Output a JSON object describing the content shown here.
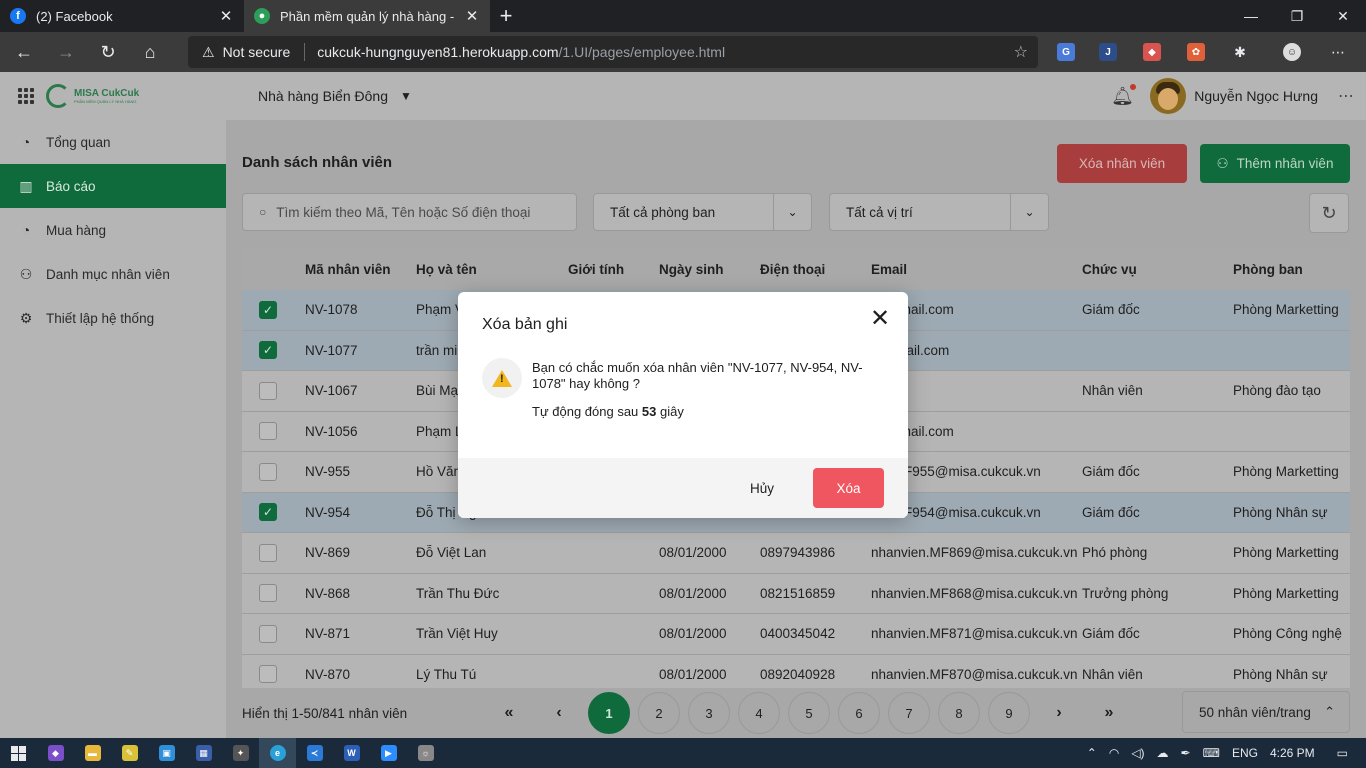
{
  "browser": {
    "tabs": [
      {
        "title": "(2) Facebook",
        "favicon": "facebook-icon",
        "active": false
      },
      {
        "title": "Phần mềm quản lý nhà hàng - C",
        "favicon": "misa-icon",
        "active": true
      }
    ],
    "security_label": "Not secure",
    "url_host": "cukcuk-hungnguyen81.herokuapp.com",
    "url_path": "/1.UI/pages/employee.html"
  },
  "app": {
    "logo_text": "MISA CukCuk",
    "logo_sub": "PHẦN MỀM QUẢN LÝ NHÀ HÀNG",
    "restaurant": "Nhà hàng Biển Đông",
    "user_name": "Nguyễn Ngọc Hưng",
    "sidebar": [
      {
        "label": "Tổng quan",
        "icon": "pie-chart-icon",
        "active": false
      },
      {
        "label": "Báo cáo",
        "icon": "bar-chart-icon",
        "active": true
      },
      {
        "label": "Mua hàng",
        "icon": "pie-chart-icon",
        "active": false
      },
      {
        "label": "Danh mục nhân viên",
        "icon": "users-icon",
        "active": false
      },
      {
        "label": "Thiết lập hệ thống",
        "icon": "gear-icon",
        "active": false
      }
    ]
  },
  "main": {
    "title": "Danh sách nhân viên",
    "delete_button": "Xóa nhân viên",
    "add_button": "Thêm nhân viên",
    "search_placeholder": "Tìm kiếm theo Mã, Tên hoặc Số điện thoại",
    "department_filter": "Tất cả phòng ban",
    "position_filter": "Tất cả vị trí",
    "columns": [
      "Mã nhân viên",
      "Họ và tên",
      "Giới tính",
      "Ngày sinh",
      "Điện thoại",
      "Email",
      "Chức vụ",
      "Phòng ban"
    ],
    "rows": [
      {
        "checked": true,
        "code": "NV-1078",
        "name": "Phạm V",
        "gender": "",
        "dob": "",
        "phone": "",
        "email": "2@gmail.com",
        "position": "Giám đốc",
        "dept": "Phòng Marketting"
      },
      {
        "checked": true,
        "code": "NV-1077",
        "name": "trần mi",
        "gender": "",
        "dob": "",
        "phone": "",
        "email": "le@mail.com",
        "position": "",
        "dept": ""
      },
      {
        "checked": false,
        "code": "NV-1067",
        "name": "Bùi Mạ",
        "gender": "",
        "dob": "",
        "phone": "",
        "email": "as",
        "position": "Nhân viên",
        "dept": "Phòng đào tạo"
      },
      {
        "checked": false,
        "code": "NV-1056",
        "name": "Phạm L",
        "gender": "",
        "dob": "",
        "phone": "",
        "email": "2@gmail.com",
        "position": "",
        "dept": ""
      },
      {
        "checked": false,
        "code": "NV-955",
        "name": "Hồ Văn",
        "gender": "",
        "dob": "",
        "phone": "",
        "email": "ien.MF955@misa.cukcuk.vn",
        "position": "Giám đốc",
        "dept": "Phòng Marketting"
      },
      {
        "checked": true,
        "code": "NV-954",
        "name": "Đỗ Thị Ng",
        "gender": "",
        "dob": "",
        "phone": "",
        "email": "ien.MF954@misa.cukcuk.vn",
        "position": "Giám đốc",
        "dept": "Phòng Nhân sự"
      },
      {
        "checked": false,
        "code": "NV-869",
        "name": "Đỗ Việt Lan",
        "gender": "",
        "dob": "08/01/2000",
        "phone": "0897943986",
        "email": "nhanvien.MF869@misa.cukcuk.vn",
        "position": "Phó phòng",
        "dept": "Phòng Marketting"
      },
      {
        "checked": false,
        "code": "NV-868",
        "name": "Trần Thu Đức",
        "gender": "",
        "dob": "08/01/2000",
        "phone": "0821516859",
        "email": "nhanvien.MF868@misa.cukcuk.vn",
        "position": "Trưởng phòng",
        "dept": "Phòng Marketting"
      },
      {
        "checked": false,
        "code": "NV-871",
        "name": "Trần Việt Huy",
        "gender": "",
        "dob": "08/01/2000",
        "phone": "0400345042",
        "email": "nhanvien.MF871@misa.cukcuk.vn",
        "position": "Giám đốc",
        "dept": "Phòng Công nghệ"
      },
      {
        "checked": false,
        "code": "NV-870",
        "name": "Lý Thu Tú",
        "gender": "",
        "dob": "08/01/2000",
        "phone": "0892040928",
        "email": "nhanvien.MF870@misa.cukcuk.vn",
        "position": "Nhân viên",
        "dept": "Phòng Nhân sự"
      }
    ],
    "count_text": "Hiển thị 1-50/841 nhân viên",
    "pages": [
      "1",
      "2",
      "3",
      "4",
      "5",
      "6",
      "7",
      "8",
      "9"
    ],
    "current_page": "1",
    "page_size": "50 nhân viên/trang"
  },
  "modal": {
    "title": "Xóa bản ghi",
    "message": "Bạn có chắc muốn xóa nhân viên \"NV-1077, NV-954, NV-1078\" hay không ?",
    "auto_close_prefix": "Tự động đóng sau ",
    "auto_close_seconds": "53",
    "auto_close_suffix": " giây",
    "cancel": "Hủy",
    "confirm": "Xóa"
  },
  "taskbar": {
    "language": "ENG",
    "time": "4:26 PM"
  }
}
